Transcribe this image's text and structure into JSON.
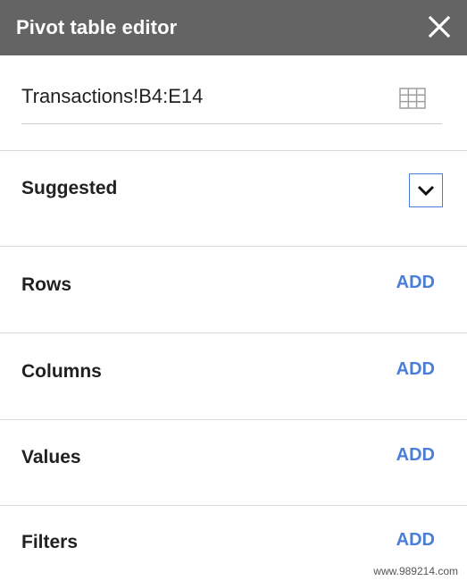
{
  "header": {
    "title": "Pivot table editor",
    "close_icon": "close-icon",
    "background": "#646464"
  },
  "range": {
    "value": "Transactions!B4:E14",
    "icon": "grid-icon"
  },
  "suggested": {
    "label": "Suggested",
    "icon": "chevron-down-icon",
    "accent": "#4a7ed6"
  },
  "sections": {
    "rows": {
      "label": "Rows",
      "action": "ADD"
    },
    "columns": {
      "label": "Columns",
      "action": "ADD"
    },
    "values": {
      "label": "Values",
      "action": "ADD"
    },
    "filters": {
      "label": "Filters",
      "action": "ADD"
    }
  },
  "watermark": "www.989214.com",
  "colors": {
    "link": "#4a7ed6",
    "divider": "#d9d9d9"
  }
}
